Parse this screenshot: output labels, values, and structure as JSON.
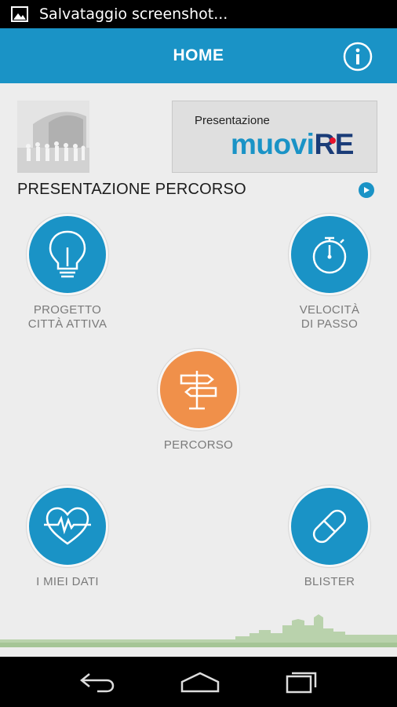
{
  "status_bar": {
    "text": "Salvataggio screenshot..."
  },
  "header": {
    "title": "HOME"
  },
  "promo": {
    "label": "Presentazione",
    "brand_part1": "muovi",
    "brand_part2": "RE"
  },
  "section": {
    "title": "PRESENTAZIONE PERCORSO"
  },
  "tiles": {
    "progetto": {
      "line1": "PROGETTO",
      "line2": "CITTÀ ATTIVA"
    },
    "velocita": {
      "line1": "VELOCITÀ",
      "line2": "DI PASSO"
    },
    "percorso": {
      "line1": "PERCORSO"
    },
    "dati": {
      "line1": "I MIEI DATI"
    },
    "blister": {
      "line1": "BLISTER"
    }
  },
  "colors": {
    "primary": "#1a93c6",
    "accent": "#f0904a",
    "brand_dark": "#1a3c78",
    "brand_red": "#e8132b"
  }
}
